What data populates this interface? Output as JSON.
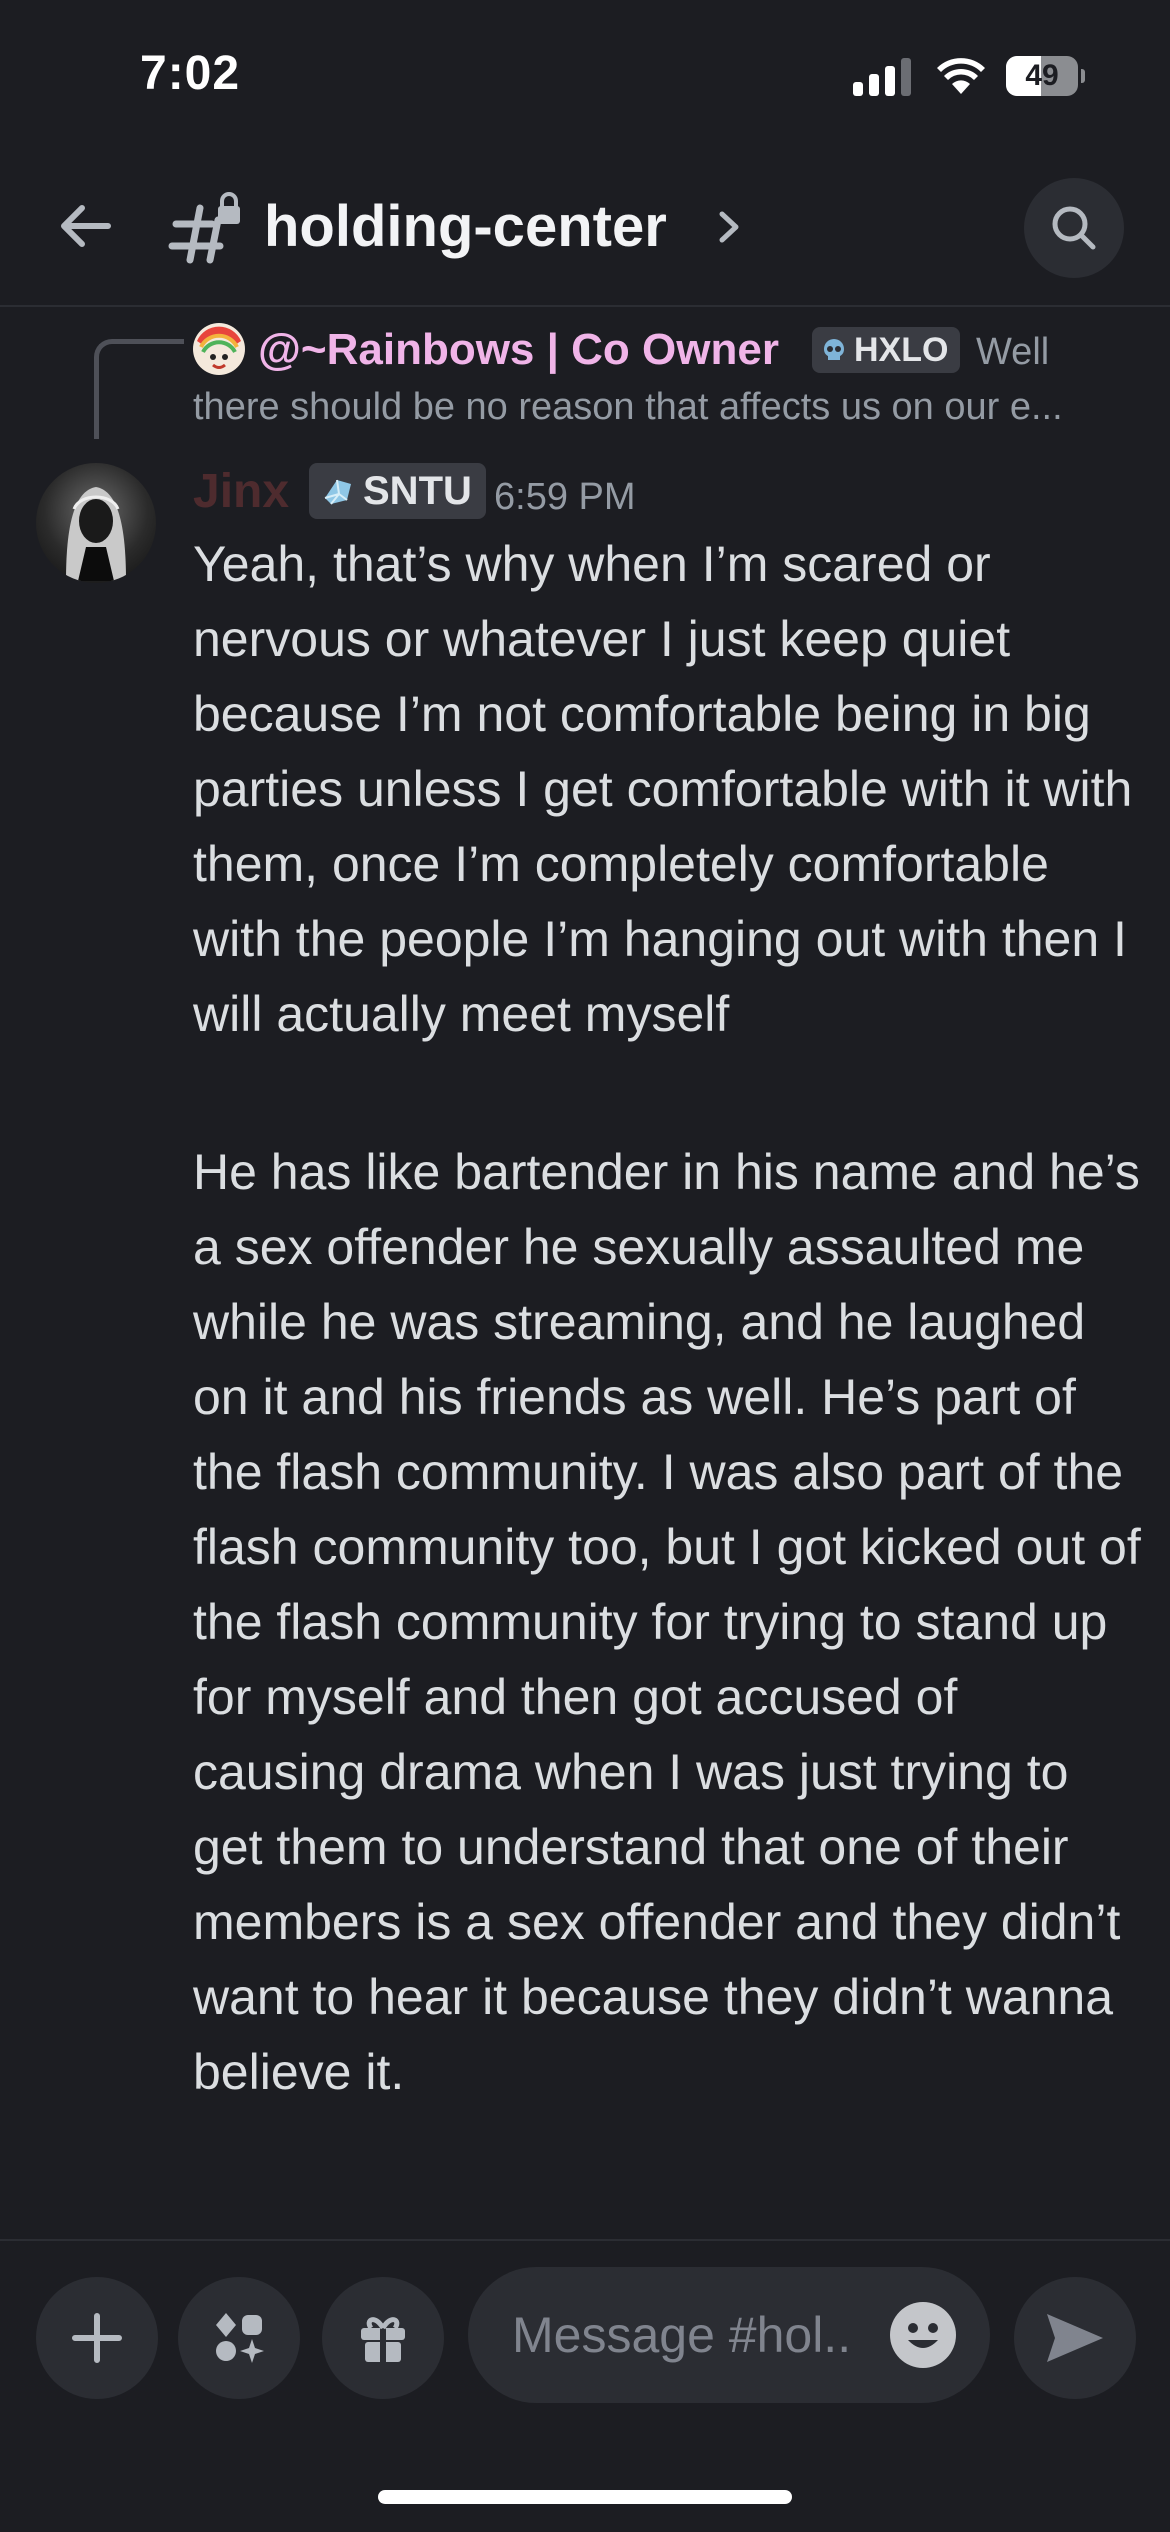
{
  "status_bar": {
    "time": "7:02",
    "battery": "49",
    "battery_level": 0.49
  },
  "header": {
    "channel_name": "holding-center"
  },
  "reply": {
    "author": "@~Rainbows | Co Owner",
    "tag": "HXLO",
    "preview_start": "Well",
    "preview_rest": "there should be no reason that affects us on our e..."
  },
  "message": {
    "author": "Jinx",
    "author_color": "#4e2b2e",
    "tag": "SNTU",
    "timestamp": "6:59 PM",
    "paragraphs": [
      "Yeah, that’s why when I’m scared or nervous or whatever I just keep quiet because I’m not comfortable being in big parties unless I get comfortable with it with them, once I’m completely comfortable with the people I’m hanging out with then I will actually meet myself",
      "He has like bartender in his name and he’s a sex offender he sexually assaulted me while he was streaming, and he laughed on it and his friends as well. He’s part of the flash community. I was also part of the flash community too, but I got kicked out of the flash community for trying to stand up for myself and then got accused of causing drama when I was just trying to get them to understand that one of their members is a sex offender and they didn’t want to hear it because they didn’t wanna believe it."
    ]
  },
  "composer": {
    "placeholder": "Message #hol..",
    "value": ""
  },
  "icons": {
    "back": "back-arrow-icon",
    "channel": "locked-channel-hash-icon",
    "search": "search-icon",
    "add": "plus-icon",
    "apps": "apps-icon",
    "gift": "gift-icon",
    "emoji": "emoji-icon",
    "send": "send-icon"
  },
  "colors": {
    "background": "#1c1d22",
    "surface": "#2b2d33",
    "reply_author": "#f0b4e8",
    "muted_text": "#949ba4"
  }
}
